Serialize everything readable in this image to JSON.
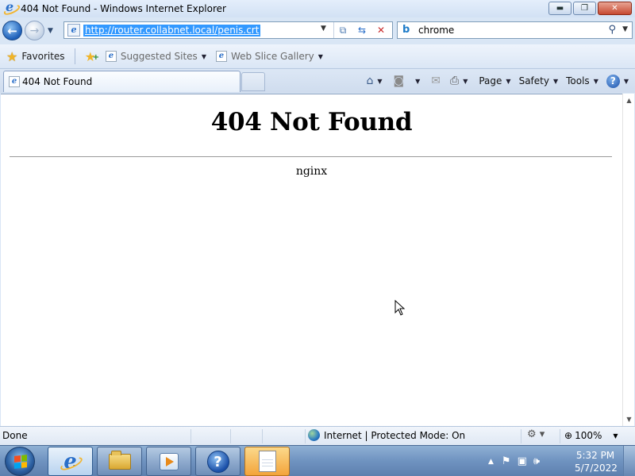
{
  "window": {
    "title": "404 Not Found - Windows Internet Explorer",
    "controls": {
      "minimize": "▬",
      "restore": "❐",
      "close": "✕"
    }
  },
  "address_bar": {
    "url": "http://router.collabnet.local/penis.crt",
    "icons": [
      "compatibility-view-icon",
      "refresh-icon",
      "stop-icon"
    ]
  },
  "search": {
    "provider_icon": "bing-icon",
    "value": "chrome"
  },
  "favorites_bar": {
    "favorites_label": "Favorites",
    "suggested_sites_label": "Suggested Sites",
    "web_slice_label": "Web Slice Gallery"
  },
  "tabs": [
    {
      "label": "404 Not Found",
      "active": true
    }
  ],
  "command_bar": {
    "page_label": "Page",
    "safety_label": "Safety",
    "tools_label": "Tools"
  },
  "page": {
    "heading": "404 Not Found",
    "server": "nginx"
  },
  "status_bar": {
    "status": "Done",
    "zone": "Internet | Protected Mode: On",
    "zoom": "100%"
  },
  "taskbar": {
    "apps": [
      "internet-explorer",
      "windows-explorer",
      "windows-media-player",
      "help-and-support",
      "notepad"
    ],
    "time": "5:32 PM",
    "date": "5/7/2022"
  },
  "colors": {
    "url_selection": "#3399ff",
    "taskbar": "#6f93c0"
  }
}
